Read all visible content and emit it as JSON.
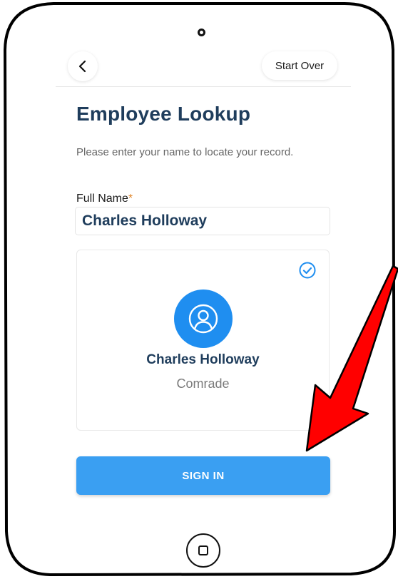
{
  "header": {
    "back_icon": "chevron-left-icon",
    "start_over_label": "Start Over"
  },
  "main": {
    "title": "Employee Lookup",
    "subtitle": "Please enter your name to locate your record.",
    "field_label": "Full Name",
    "required_marker": "*",
    "full_name_value": "Charles Holloway"
  },
  "result_card": {
    "selected": true,
    "name": "Charles Holloway",
    "role": "Comrade",
    "avatar_icon": "user-icon",
    "check_icon": "check-circle-icon"
  },
  "actions": {
    "sign_in_label": "SIGN IN"
  },
  "device": {
    "home_icon": "home-button-icon"
  },
  "colors": {
    "title": "#1f3d5c",
    "primary_button": "#3a9ff2",
    "avatar": "#1f8ef0",
    "required": "#e0862a",
    "annotation_arrow": "#ff0000"
  }
}
